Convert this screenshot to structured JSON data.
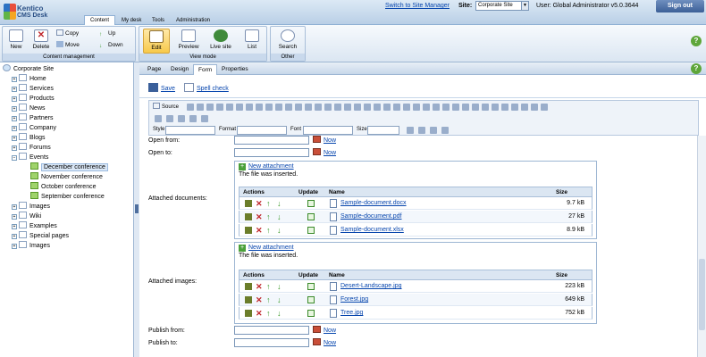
{
  "header": {
    "logo_line1": "Kentico",
    "logo_line2": "CMS Desk",
    "tabs": [
      "Content",
      "My desk",
      "Tools",
      "Administration"
    ],
    "switch_link": "Switch to Site Manager",
    "site_label": "Site:",
    "site_value": "Corporate Site",
    "user_text": "User: Global Administrator  v5.0.3644",
    "signout": "Sign out"
  },
  "ribbon": {
    "content_management": {
      "label": "Content management",
      "new": "New",
      "delete": "Delete",
      "copy": "Copy",
      "move": "Move",
      "up": "Up",
      "down": "Down"
    },
    "view_mode": {
      "label": "View mode",
      "edit": "Edit",
      "preview": "Preview",
      "live_site": "Live site",
      "list": "List"
    },
    "other": {
      "label": "Other",
      "search": "Search"
    },
    "help": "?"
  },
  "tree": {
    "root": "Corporate Site",
    "items": [
      "Home",
      "Services",
      "Products",
      "News",
      "Partners",
      "Company",
      "Blogs",
      "Forums",
      "Events"
    ],
    "events_children": [
      "December conference",
      "November conference",
      "October conference",
      "September conference"
    ],
    "after": [
      "Images",
      "Wiki",
      "Examples",
      "Special pages",
      "Images"
    ]
  },
  "subtabs": [
    "Page",
    "Design",
    "Form",
    "Properties"
  ],
  "savebar": {
    "save": "Save",
    "spell": "Spell check"
  },
  "editor": {
    "source": "Source",
    "style": "Style",
    "format": "Format",
    "font": "Font",
    "size": "Size"
  },
  "form": {
    "open_from": "Open from:",
    "open_to": "Open to:",
    "attached_documents": "Attached documents:",
    "attached_images": "Attached images:",
    "publish_from": "Publish from:",
    "publish_to": "Publish to:",
    "now": "Now",
    "new_attachment": "New attachment",
    "inserted_msg": "The file was inserted.",
    "grid_headers": {
      "actions": "Actions",
      "update": "Update",
      "name": "Name",
      "size": "Size"
    },
    "documents": [
      {
        "name": "Sample-document.docx",
        "size": "9.7 kB"
      },
      {
        "name": "Sample-document.pdf",
        "size": "27 kB"
      },
      {
        "name": "Sample-document.xlsx",
        "size": "8.9 kB"
      }
    ],
    "images": [
      {
        "name": "Desert-Landscape.jpg",
        "size": "223 kB"
      },
      {
        "name": "Forest.jpg",
        "size": "649 kB"
      },
      {
        "name": "Tree.jpg",
        "size": "752 kB"
      }
    ]
  }
}
